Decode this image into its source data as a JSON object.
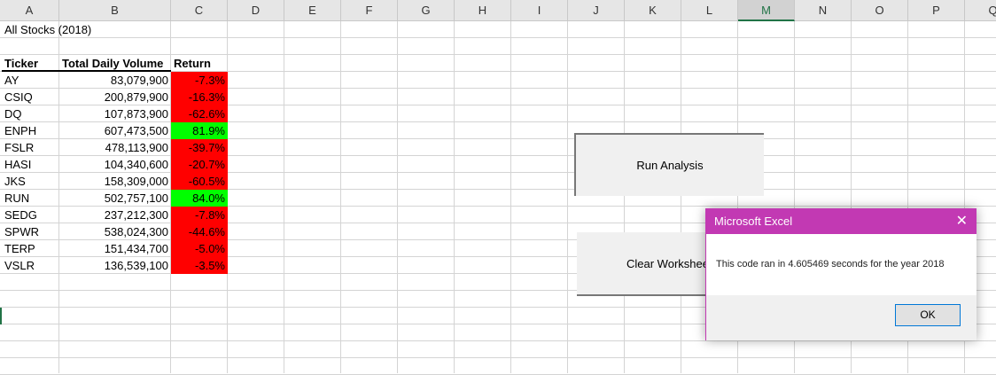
{
  "columns": [
    "A",
    "B",
    "C",
    "D",
    "E",
    "F",
    "G",
    "H",
    "I",
    "J",
    "K",
    "L",
    "M",
    "N",
    "O",
    "P",
    "Q"
  ],
  "selected_column": "M",
  "sheet": {
    "title": "All Stocks (2018)",
    "headers": [
      "Ticker",
      "Total Daily Volume",
      "Return"
    ],
    "rows": [
      {
        "ticker": "AY",
        "volume": "83,079,900",
        "return": "-7.3%",
        "color": "#ff0000"
      },
      {
        "ticker": "CSIQ",
        "volume": "200,879,900",
        "return": "-16.3%",
        "color": "#ff0000"
      },
      {
        "ticker": "DQ",
        "volume": "107,873,900",
        "return": "-62.6%",
        "color": "#ff0000"
      },
      {
        "ticker": "ENPH",
        "volume": "607,473,500",
        "return": "81.9%",
        "color": "#00ff00"
      },
      {
        "ticker": "FSLR",
        "volume": "478,113,900",
        "return": "-39.7%",
        "color": "#ff0000"
      },
      {
        "ticker": "HASI",
        "volume": "104,340,600",
        "return": "-20.7%",
        "color": "#ff0000"
      },
      {
        "ticker": "JKS",
        "volume": "158,309,000",
        "return": "-60.5%",
        "color": "#ff0000"
      },
      {
        "ticker": "RUN",
        "volume": "502,757,100",
        "return": "84.0%",
        "color": "#00ff00"
      },
      {
        "ticker": "SEDG",
        "volume": "237,212,300",
        "return": "-7.8%",
        "color": "#ff0000"
      },
      {
        "ticker": "SPWR",
        "volume": "538,024,300",
        "return": "-44.6%",
        "color": "#ff0000"
      },
      {
        "ticker": "TERP",
        "volume": "151,434,700",
        "return": "-5.0%",
        "color": "#ff0000"
      },
      {
        "ticker": "VSLR",
        "volume": "136,539,100",
        "return": "-3.5%",
        "color": "#ff0000"
      }
    ]
  },
  "buttons": {
    "run": "Run Analysis",
    "clear": "Clear Worksheet"
  },
  "dialog": {
    "title": "Microsoft Excel",
    "message": "This code ran in 4.605469 seconds for the year 2018",
    "ok": "OK",
    "close_icon": "close-icon",
    "accent": "#c239b3"
  }
}
